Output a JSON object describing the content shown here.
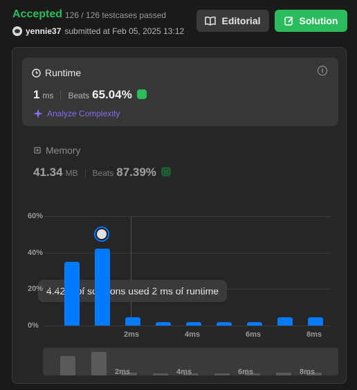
{
  "submission": {
    "status": "Accepted",
    "testcases": "126 / 126 testcases passed",
    "user": "yennie37",
    "submitted_text": "submitted at Feb 05, 2025 13:12"
  },
  "buttons": {
    "editorial": "Editorial",
    "solution": "Solution"
  },
  "runtime": {
    "title": "Runtime",
    "value": "1",
    "unit": "ms",
    "beats_label": "Beats",
    "beats": "65.04%",
    "analyze": "Analyze Complexity"
  },
  "memory": {
    "title": "Memory",
    "value": "41.34",
    "unit": "MB",
    "beats_label": "Beats",
    "beats": "87.39%"
  },
  "chart_data": {
    "type": "bar",
    "yticks": [
      "60%",
      "40%",
      "20%",
      "0%"
    ],
    "xticks": [
      "2ms",
      "4ms",
      "6ms",
      "8ms"
    ],
    "x": [
      0,
      1,
      2,
      3,
      4,
      5,
      6,
      7,
      8
    ],
    "values": [
      35,
      42,
      4.42,
      2,
      2,
      2,
      2,
      4.5,
      4.5
    ],
    "ylim": [
      0,
      60
    ],
    "highlighted_bar_index": 1,
    "tooltip": "4.42% of solutions used 2 ms of runtime"
  },
  "colors": {
    "accent_green": "#2cbb5d",
    "bar_blue": "#007aff",
    "purple": "#8a6df0"
  }
}
